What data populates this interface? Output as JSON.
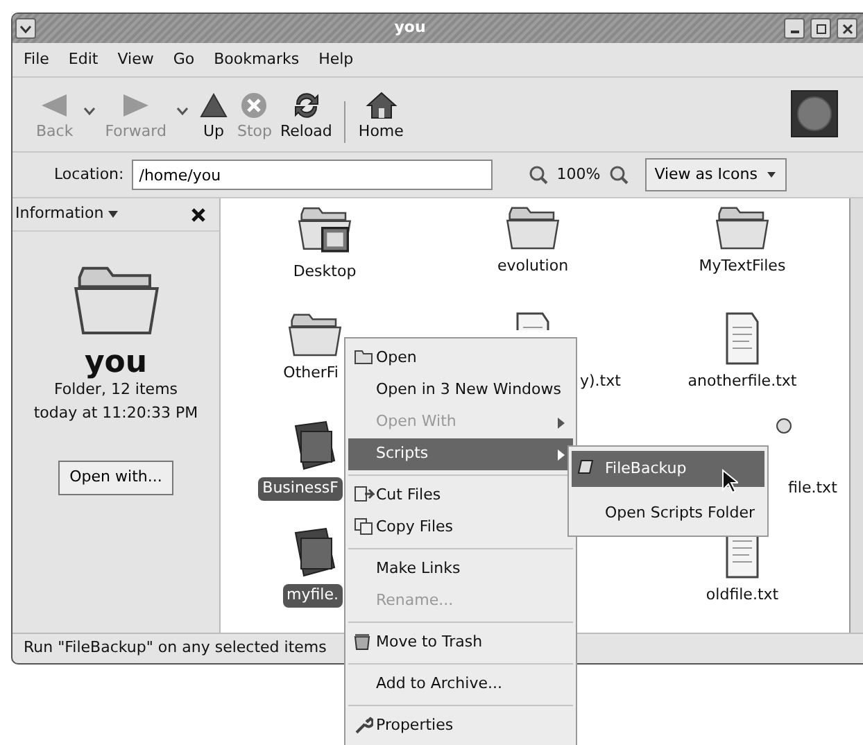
{
  "window": {
    "title": "you"
  },
  "menu_bar": [
    "File",
    "Edit",
    "View",
    "Go",
    "Bookmarks",
    "Help"
  ],
  "toolbar": [
    {
      "kind": "back",
      "label": "Back",
      "disabled": true
    },
    {
      "kind": "forward",
      "label": "Forward",
      "disabled": true
    },
    {
      "kind": "up",
      "label": "Up",
      "disabled": false
    },
    {
      "kind": "stop",
      "label": "Stop",
      "disabled": true
    },
    {
      "kind": "reload",
      "label": "Reload",
      "disabled": false
    },
    {
      "kind": "home",
      "label": "Home",
      "disabled": false
    }
  ],
  "location_bar": {
    "label": "Location:",
    "value": "/home/you",
    "zoom": "100%",
    "view_mode": "View as Icons"
  },
  "sidebar": {
    "panel": "Information",
    "name": "you",
    "details": [
      "Folder, 12 items",
      "today at 11:20:33 PM"
    ],
    "button": "Open with..."
  },
  "icon_rows": [
    [
      {
        "kind": "desktop",
        "label": "Desktop",
        "selected": false
      },
      {
        "kind": "folder",
        "label": "evolution",
        "selected": false
      },
      {
        "kind": "folder",
        "label": "MyTextFiles",
        "selected": false
      }
    ],
    [
      {
        "kind": "folder",
        "label": "OtherFi",
        "selected": false
      },
      {
        "kind": "text",
        "label": "y).txt",
        "selected": false
      },
      {
        "kind": "text",
        "label": "anotherfile.txt",
        "selected": false
      }
    ],
    [
      {
        "kind": "image",
        "label": "BusinessF",
        "selected": true
      },
      null,
      {
        "kind": "script",
        "label": "file.txt",
        "selected": false
      }
    ],
    [
      {
        "kind": "image",
        "label": "myfile.",
        "selected": true
      },
      null,
      {
        "kind": "text",
        "label": "oldfile.txt",
        "selected": false
      }
    ]
  ],
  "status_bar": "Run \"FileBackup\" on any selected items",
  "context_menu": [
    {
      "kind": "open",
      "label": "Open",
      "disabled": false,
      "selected": false
    },
    {
      "kind": "item",
      "label": "Open in 3 New Windows",
      "disabled": false,
      "selected": false
    },
    {
      "kind": "submenu",
      "label": "Open With",
      "disabled": true,
      "selected": false
    },
    {
      "kind": "submenu",
      "label": "Scripts",
      "disabled": false,
      "selected": true
    },
    {
      "kind": "separator"
    },
    {
      "kind": "cut",
      "label": "Cut Files",
      "disabled": false,
      "selected": false
    },
    {
      "kind": "copy",
      "label": "Copy Files",
      "disabled": false,
      "selected": false
    },
    {
      "kind": "separator"
    },
    {
      "kind": "item",
      "label": "Make Links",
      "disabled": false,
      "selected": false
    },
    {
      "kind": "item",
      "label": "Rename...",
      "disabled": true,
      "selected": false
    },
    {
      "kind": "separator"
    },
    {
      "kind": "trash",
      "label": "Move to Trash",
      "disabled": false,
      "selected": false
    },
    {
      "kind": "separator"
    },
    {
      "kind": "item",
      "label": "Add to Archive...",
      "disabled": false,
      "selected": false
    },
    {
      "kind": "separator"
    },
    {
      "kind": "properties",
      "label": "Properties",
      "disabled": false,
      "selected": false
    }
  ],
  "scripts_submenu": [
    {
      "kind": "script",
      "label": "FileBackup",
      "selected": true
    },
    {
      "kind": "item",
      "label": "Open Scripts Folder",
      "selected": false
    }
  ]
}
